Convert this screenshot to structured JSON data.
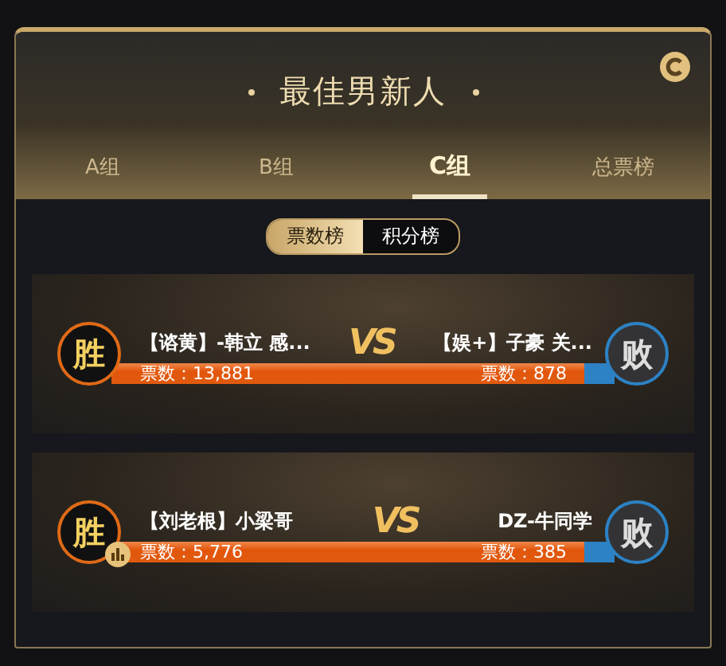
{
  "title": "最佳男新人",
  "tabs": [
    {
      "label": "A组",
      "selected": false
    },
    {
      "label": "B组",
      "selected": false
    },
    {
      "label": "C组",
      "selected": true
    },
    {
      "label": "总票榜",
      "selected": false
    }
  ],
  "toggle": [
    {
      "label": "票数榜",
      "selected": true
    },
    {
      "label": "积分榜",
      "selected": false
    }
  ],
  "matches": [
    {
      "left": {
        "name": "【谘黄】-韩立 感...",
        "votes": "票数：13,881",
        "result": "胜",
        "badge": false
      },
      "vs": "VS",
      "right": {
        "name": "【娱+】子豪 关...",
        "votes": "票数：878",
        "result": "败"
      },
      "level": 0.94
    },
    {
      "left": {
        "name": "【刘老根】小梁哥",
        "votes": "票数：5,776",
        "result": "胜",
        "badge": true
      },
      "vs": "VS",
      "right": {
        "name": "DZ-牛同学",
        "votes": "票数：385",
        "result": "败"
      },
      "level": 0.94
    }
  ]
}
